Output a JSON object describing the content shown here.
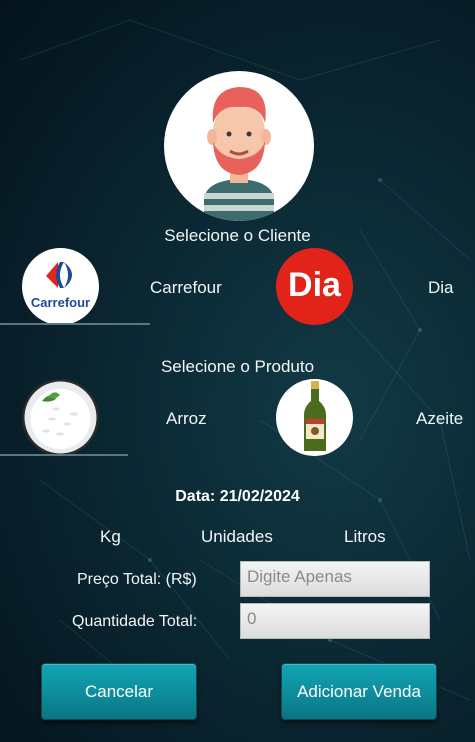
{
  "avatar": {
    "icon": "bearded-man-avatar"
  },
  "client_section": {
    "title": "Selecione o Cliente",
    "options": [
      {
        "logo_text": "Carrefour",
        "label": "Carrefour"
      },
      {
        "logo_text": "Dia",
        "label": "Dia"
      }
    ]
  },
  "product_section": {
    "title": "Selecione o Produto",
    "options": [
      {
        "label": "Arroz",
        "icon": "rice-bowl"
      },
      {
        "label": "Azeite",
        "icon": "olive-oil-bottle"
      }
    ]
  },
  "date": {
    "text": "Data: 21/02/2024"
  },
  "units": [
    "Kg",
    "Unidades",
    "Litros"
  ],
  "price": {
    "label": "Preço Total: (R$)",
    "placeholder": "Digite Apenas"
  },
  "quantity": {
    "label": "Quantidade Total:",
    "value": "0"
  },
  "buttons": {
    "cancel": "Cancelar",
    "add": "Adicionar Venda"
  },
  "colors": {
    "accent": "#0e95a3",
    "dia_red": "#e2231a",
    "carrefour_blue": "#1f4a9c"
  }
}
